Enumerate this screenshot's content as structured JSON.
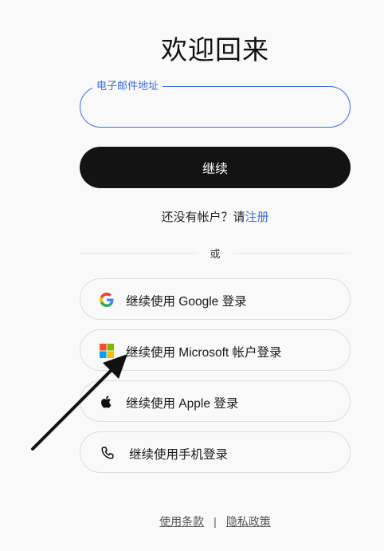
{
  "page": {
    "title": "欢迎回来"
  },
  "email": {
    "label": "电子邮件地址",
    "value": ""
  },
  "continue": {
    "label": "继续"
  },
  "signup": {
    "prompt": "还没有帐户？请",
    "link": "注册"
  },
  "divider": {
    "text": "或"
  },
  "social": [
    {
      "label": "继续使用 Google 登录",
      "icon": "google-icon"
    },
    {
      "label": "继续使用 Microsoft 帐户登录",
      "icon": "microsoft-icon"
    },
    {
      "label": "继续使用 Apple 登录",
      "icon": "apple-icon"
    },
    {
      "label": "继续使用手机登录",
      "icon": "phone-icon"
    }
  ],
  "footer": {
    "terms": "使用条款",
    "separator": "|",
    "privacy": "隐私政策"
  },
  "colors": {
    "accent": "#3b6fd8",
    "primary_button": "#131313",
    "background": "#f9f9f9"
  }
}
